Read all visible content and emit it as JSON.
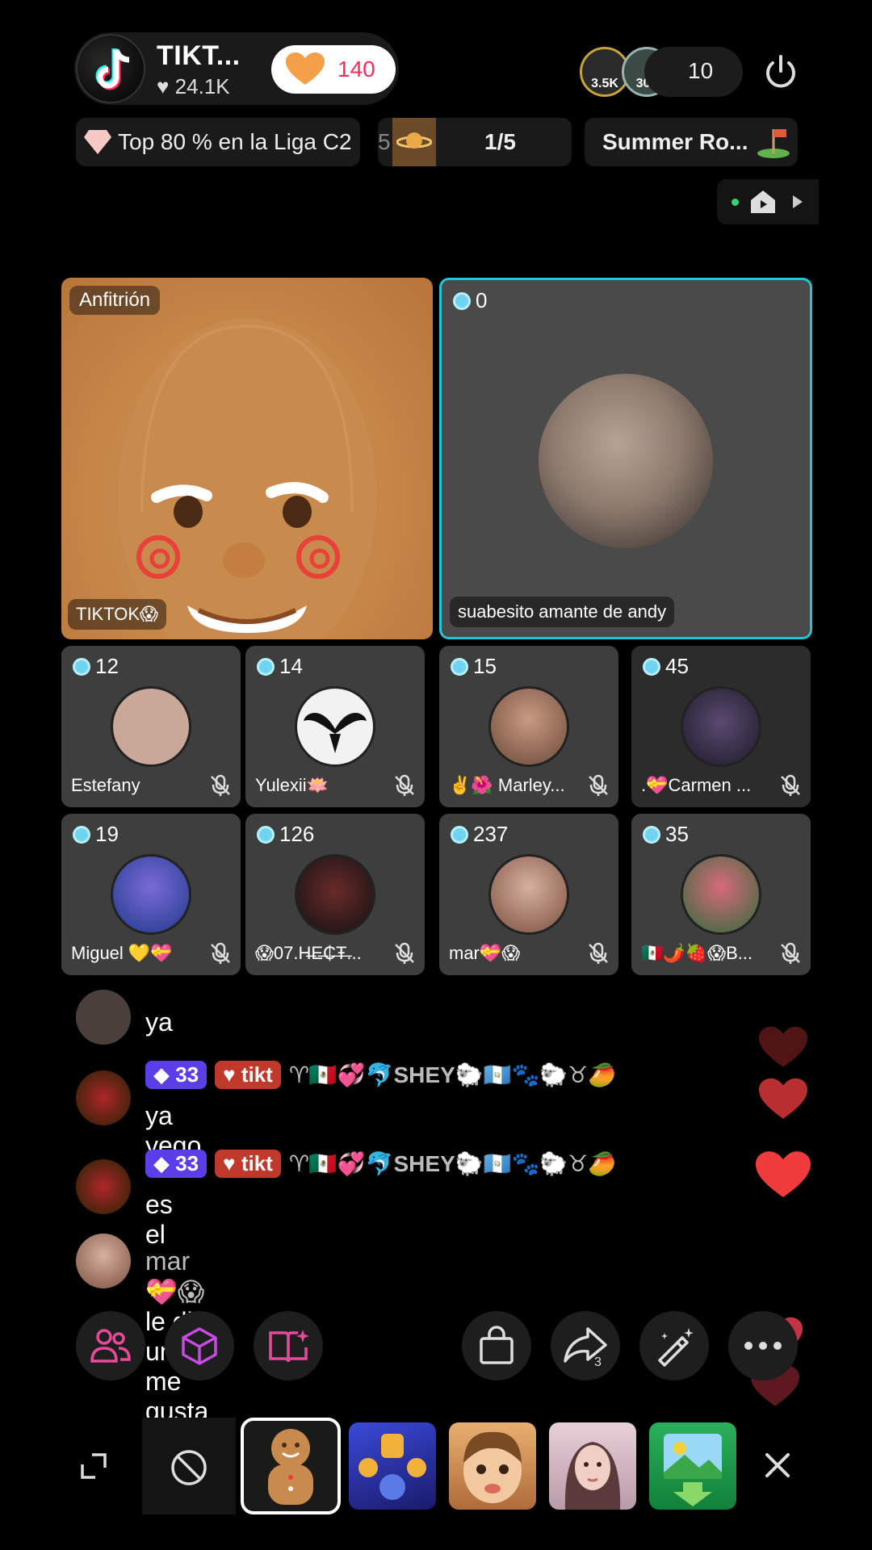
{
  "host": {
    "name": "TIKT...",
    "likes": "24.1K",
    "like_count": "140",
    "badge": "Anfitrión",
    "stream_name": "TIKTOK😱"
  },
  "viewers": {
    "top1": "3.5K",
    "top2": "304",
    "count": "10"
  },
  "banners": {
    "league": "Top 80 % en la Liga C2",
    "progress_prefix": "5",
    "progress": "1/5",
    "event": "Summer Ro..."
  },
  "guest_main": {
    "score": "0",
    "name": "suabesito amante de andy"
  },
  "guests": [
    {
      "score": "12",
      "name": "Estefany",
      "color": "#c9a89a"
    },
    {
      "score": "14",
      "name": "Yulexii🪷",
      "color": "#f0f0f0"
    },
    {
      "score": "15",
      "name": "✌️🌺 Marley...",
      "color": "#6b4a3a"
    },
    {
      "score": "45",
      "name": ".💝Carmen ...",
      "color": "#3a2f4a"
    },
    {
      "score": "19",
      "name": "Miguel 💛💝",
      "color": "#3a5aa8"
    },
    {
      "score": "126",
      "name": "😱07.H̶E̶₵̶Ŧ̶...",
      "color": "#402020"
    },
    {
      "score": "237",
      "name": "mar💝😱",
      "color": "#b88a78"
    },
    {
      "score": "35",
      "name": "🇲🇽🌶️🍓😱B...",
      "color": "#2e6b3a"
    }
  ],
  "chat": {
    "partial_text": "ya",
    "messages": [
      {
        "level": "33",
        "fan": "tikt",
        "user": "♈🇲🇽💞🐬SHEY🐑🇬🇹🐾🐑♉🥭",
        "text": "ya yego"
      },
      {
        "level": "33",
        "fan": "tikt",
        "user": "♈🇲🇽💞🐬SHEY🐑🇬🇹🐾🐑♉🥭",
        "text": "es el"
      }
    ],
    "like_event": {
      "user": "mar💝😱",
      "text": "le dio un me gusta al LIVE"
    }
  },
  "actions": {
    "share_count": "3"
  },
  "colors": {
    "accent": "#fe2c55",
    "guest_border": "#1fc7d4",
    "level_badge": "#5b3ee8",
    "fan_badge": "#c0392b"
  }
}
